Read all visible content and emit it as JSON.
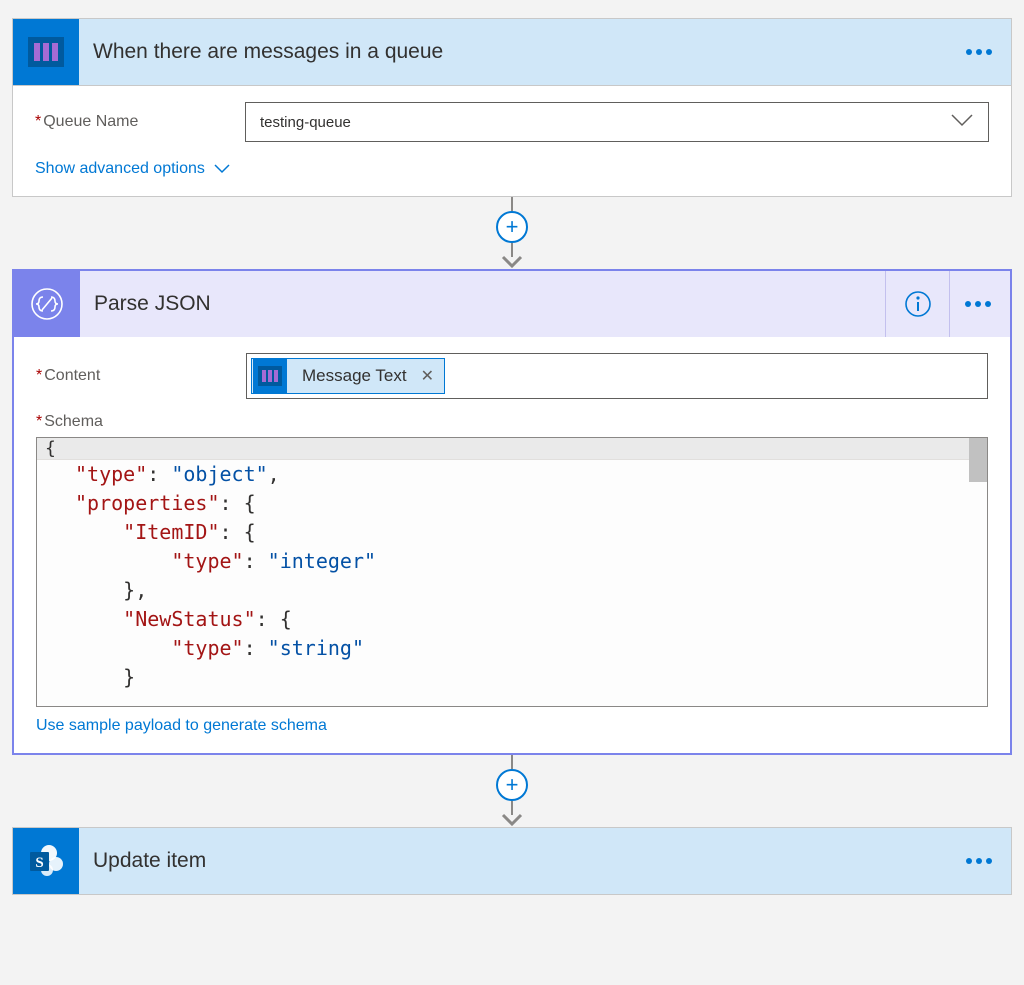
{
  "card1": {
    "title": "When there are messages in a queue",
    "field_label": "Queue Name",
    "field_value": "testing-queue",
    "adv_link": "Show advanced options"
  },
  "card2": {
    "title": "Parse JSON",
    "content_label": "Content",
    "token_text": "Message Text",
    "schema_label": "Schema",
    "schema_json": {
      "type": "object",
      "properties": {
        "ItemID": {
          "type": "integer"
        },
        "NewStatus": {
          "type": "string"
        }
      }
    },
    "payload_link": "Use sample payload to generate schema"
  },
  "card3": {
    "title": "Update item"
  },
  "icons": {
    "queue": "queue-icon",
    "code": "code-braces-icon",
    "sharepoint": "sharepoint-icon",
    "info": "info-icon",
    "menu": "menu-dots-icon",
    "chevron_down": "chevron-down-icon",
    "close": "close-icon",
    "plus": "plus-icon"
  },
  "colors": {
    "blue": "#0078d4",
    "lightblue": "#d0e7f8",
    "purple": "#7b83eb",
    "lightpurple": "#e8e7fb"
  }
}
